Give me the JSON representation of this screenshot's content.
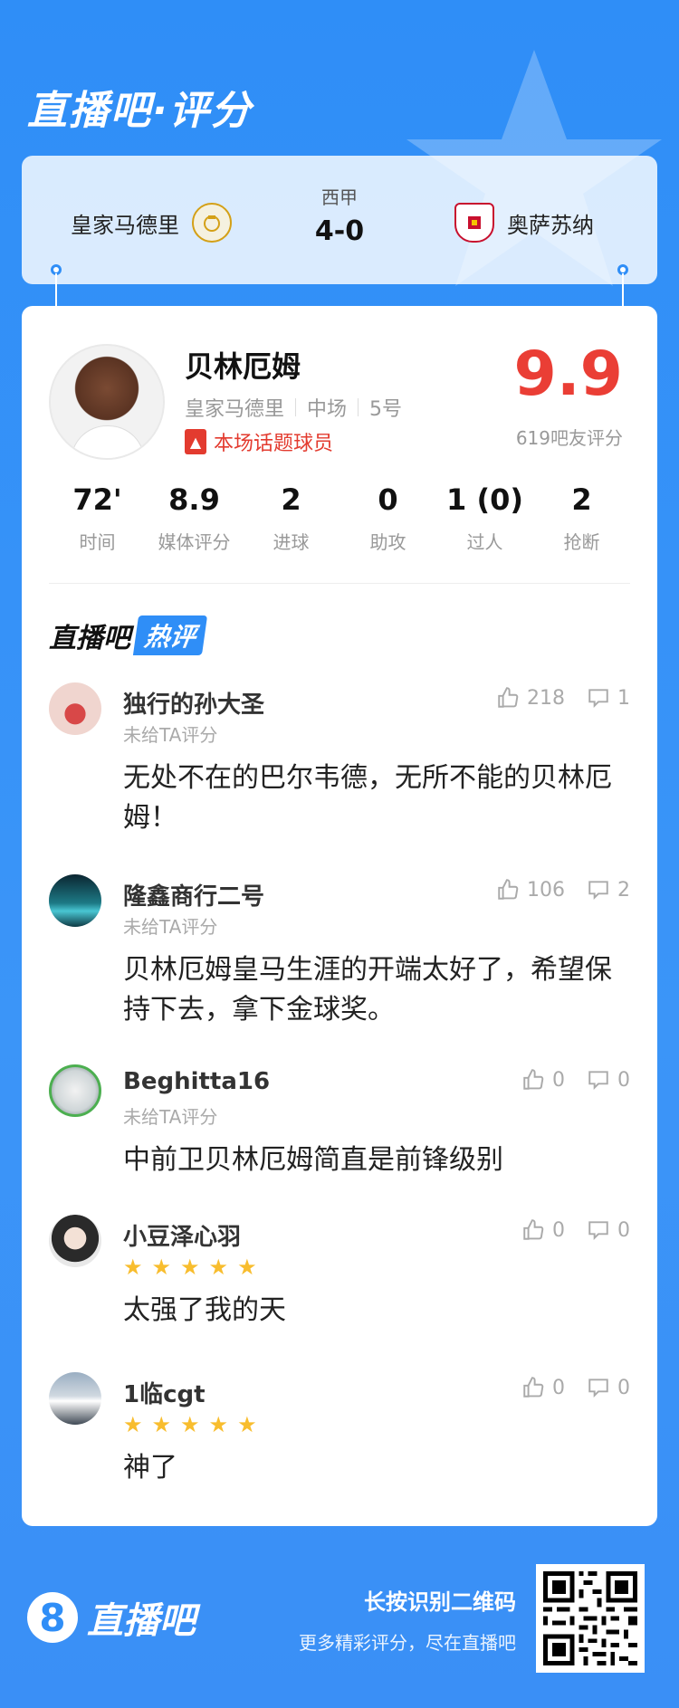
{
  "brand": {
    "title": "直播吧·评分"
  },
  "match": {
    "home_team": "皇家马德里",
    "away_team": "奥萨苏纳",
    "league": "西甲",
    "score": "4-0"
  },
  "player": {
    "name": "贝林厄姆",
    "club": "皇家马德里",
    "position": "中场",
    "number": "5号",
    "tag": "本场话题球员",
    "rating": "9.9",
    "fan_rating_label": "619吧友评分"
  },
  "stats": [
    {
      "value": "72'",
      "label": "时间"
    },
    {
      "value": "8.9",
      "label": "媒体评分"
    },
    {
      "value": "2",
      "label": "进球"
    },
    {
      "value": "0",
      "label": "助攻"
    },
    {
      "value": "1 (0)",
      "label": "过人"
    },
    {
      "value": "2",
      "label": "抢断"
    }
  ],
  "hot_header": {
    "part1": "直播吧",
    "part2": "热评"
  },
  "comments": [
    {
      "name": "独行的孙大圣",
      "sub": "未给TA评分",
      "stars": 0,
      "likes": "218",
      "replies": "1",
      "text": "无处不在的巴尔韦德，无所不能的贝林厄姆！",
      "avatar_color": "#d85a5a"
    },
    {
      "name": "隆鑫商行二号",
      "sub": "未给TA评分",
      "stars": 0,
      "likes": "106",
      "replies": "2",
      "text": "贝林厄姆皇马生涯的开端太好了，希望保持下去，拿下金球奖。",
      "avatar_color": "#1d6e7a"
    },
    {
      "name": "Beghitta16",
      "sub": "未给TA评分",
      "stars": 0,
      "likes": "0",
      "replies": "0",
      "text": "中前卫贝林厄姆简直是前锋级别",
      "avatar_color": "#8fa3a5"
    },
    {
      "name": "小豆泽心羽",
      "sub": "",
      "stars": 5,
      "likes": "0",
      "replies": "0",
      "text": "太强了我的天",
      "avatar_color": "#3a3a3a"
    },
    {
      "name": "1临cgt",
      "sub": "",
      "stars": 5,
      "likes": "0",
      "replies": "0",
      "text": "神了",
      "avatar_color": "#7b8a9a"
    }
  ],
  "footer": {
    "logo_text": "直播吧",
    "logo_mark": "8",
    "tip_title": "长按识别二维码",
    "tip_sub": "更多精彩评分，尽在直播吧"
  }
}
